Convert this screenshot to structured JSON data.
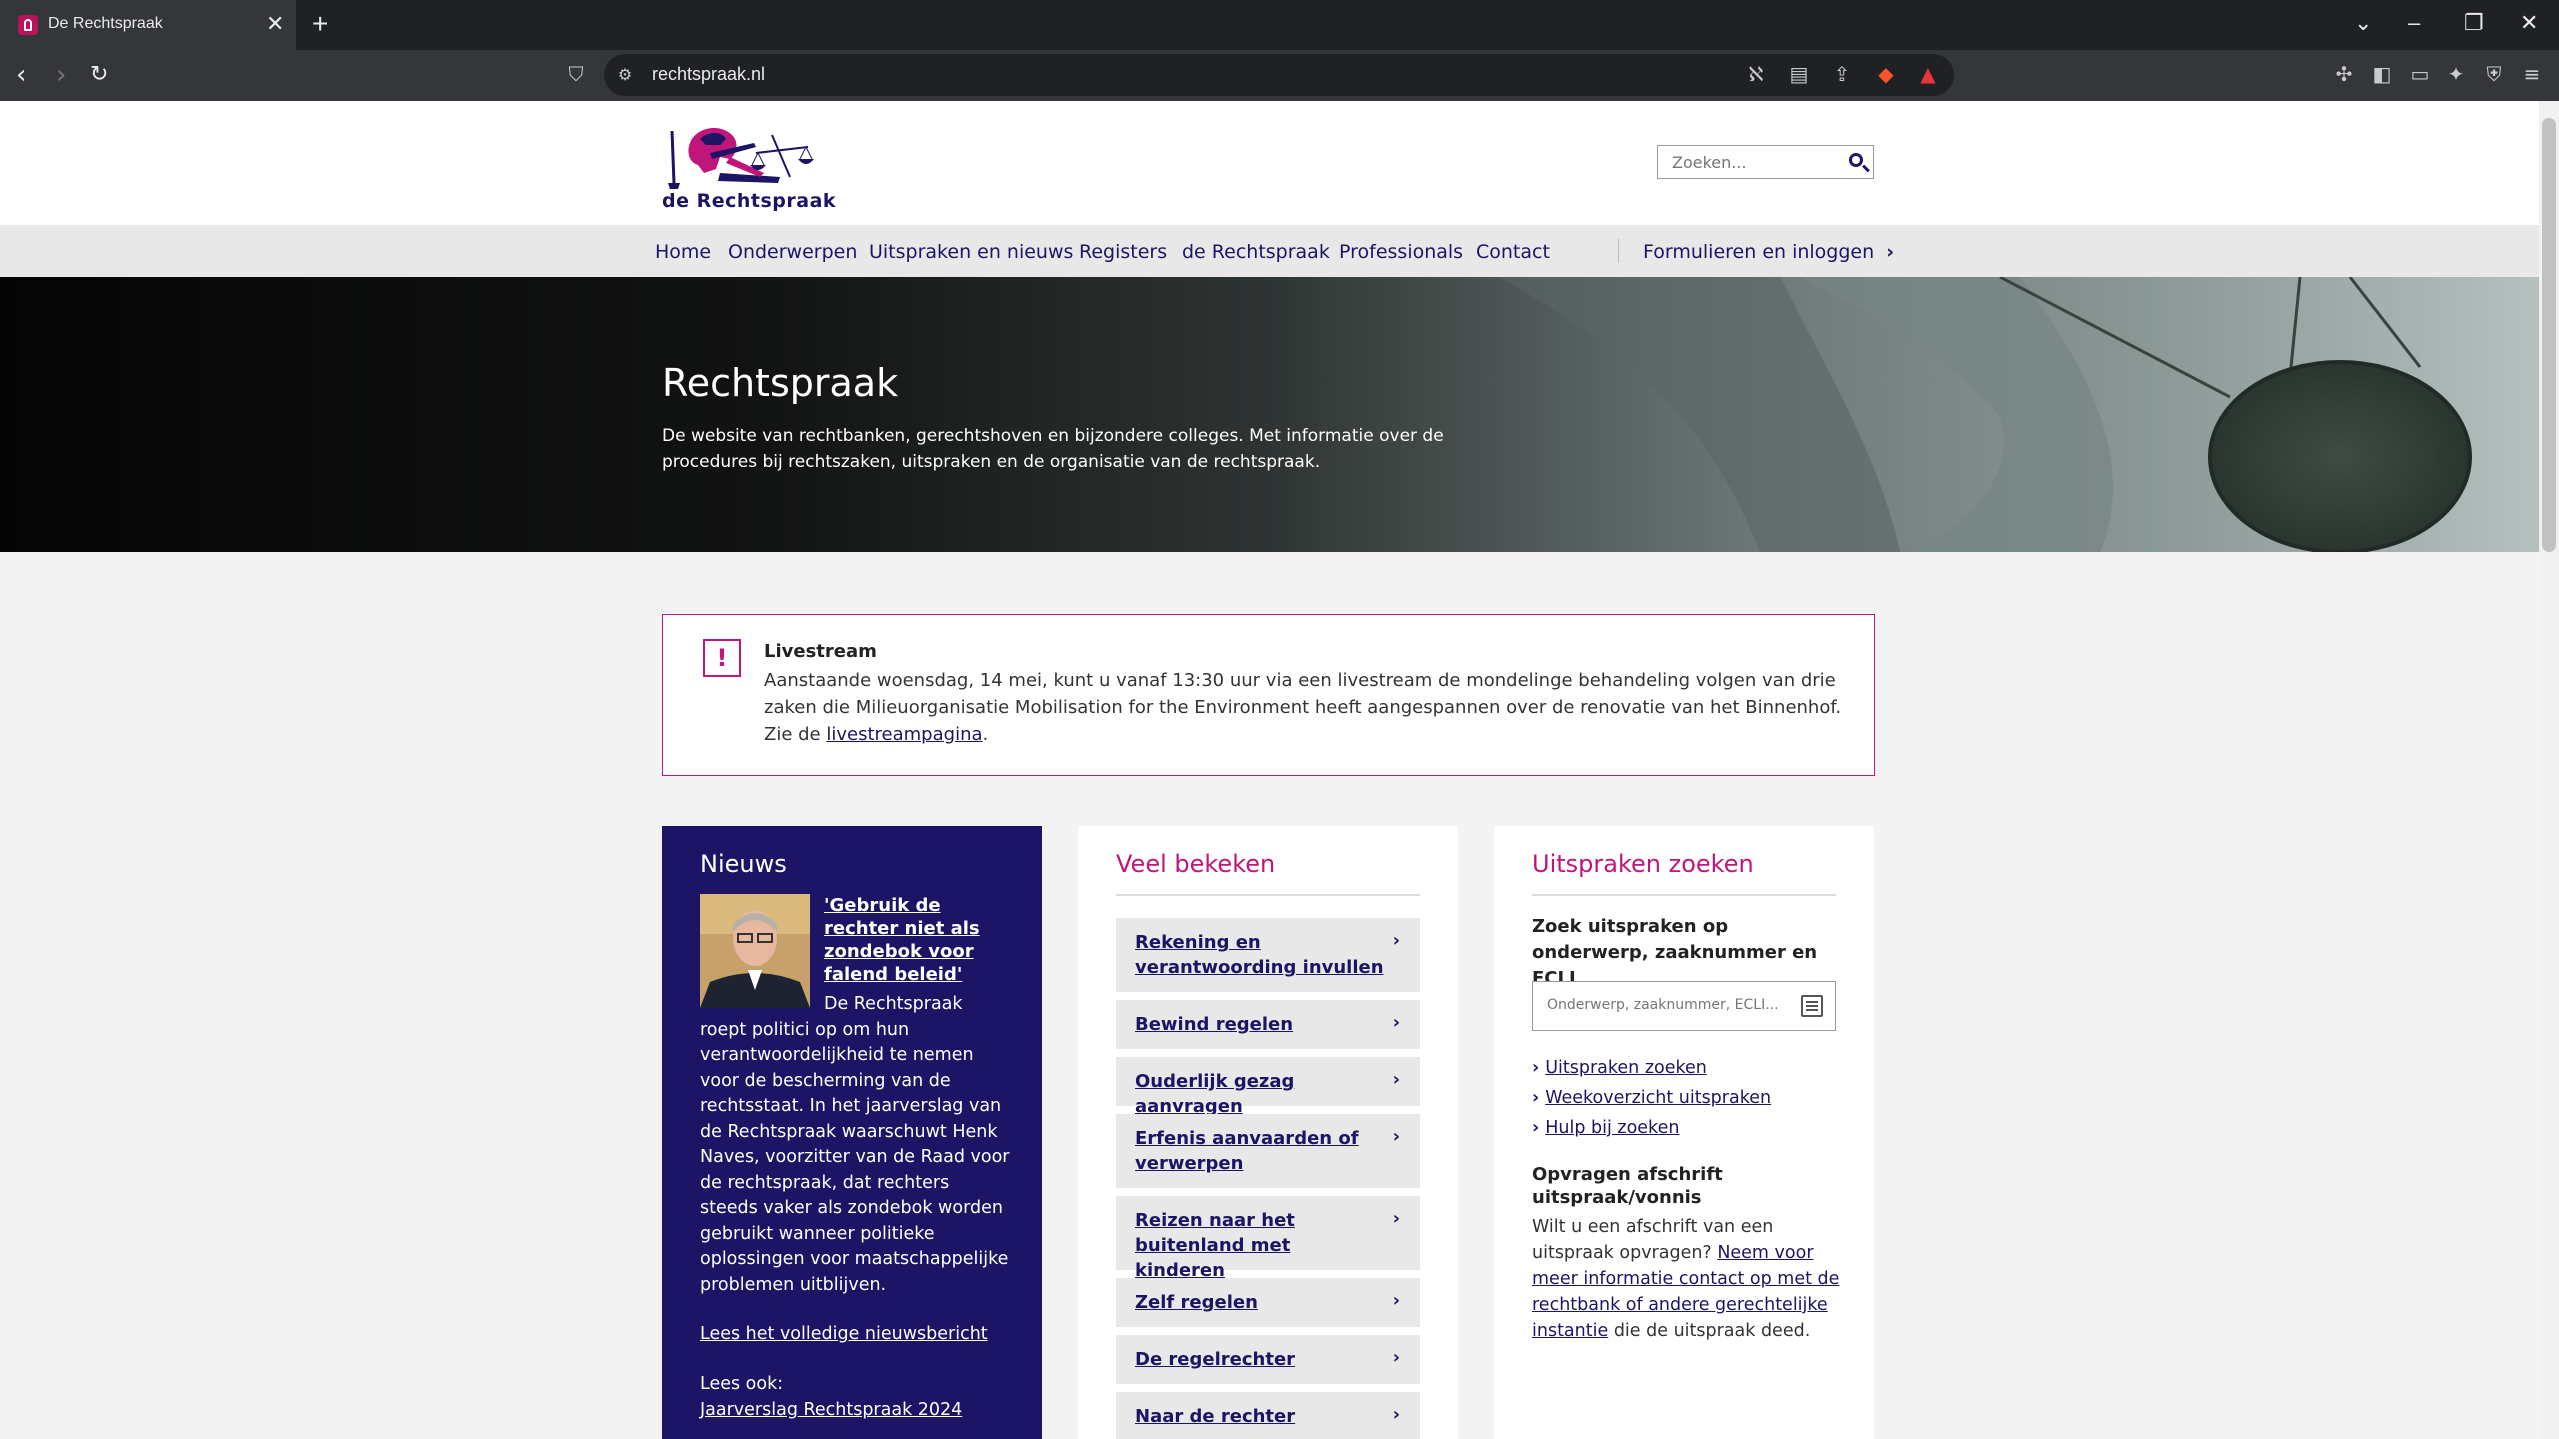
{
  "browser": {
    "tab_title": "De Rechtspraak",
    "tab_close": "✕",
    "new_tab": "+",
    "url": "rechtspraak.nl"
  },
  "site": {
    "logo_text": "de Rechtspraak",
    "search_placeholder": "Zoeken..."
  },
  "nav": {
    "items": [
      {
        "label": "Home"
      },
      {
        "label": "Onderwerpen"
      },
      {
        "label": "Uitspraken en nieuws"
      },
      {
        "label": "Registers"
      },
      {
        "label": "de Rechtspraak"
      },
      {
        "label": "Professionals"
      },
      {
        "label": "Contact"
      }
    ],
    "login": "Formulieren en inloggen",
    "login_chevron": "›"
  },
  "hero": {
    "title": "Rechtspraak",
    "text": "De website van rechtbanken, gerechtshoven en bijzondere colleges. Met informatie over de procedures bij rechtszaken, uitspraken en de organisatie van de rechtspraak."
  },
  "alert": {
    "icon": "!",
    "title": "Livestream",
    "body": "Aanstaande woensdag, 14 mei, kunt u vanaf 13:30 uur via een livestream de mondelinge behandeling volgen van drie zaken die Milieuorganisatie Mobilisation for the Environment heeft aangespannen over de renovatie van het Binnenhof. Zie de",
    "link": "livestreampagina",
    "end": "."
  },
  "news": {
    "title": "Nieuws",
    "headline": "'Gebruik de rechter niet als zondebok voor falend beleid'",
    "body": "De Rechtspraak roept politici op om hun verantwoordelijkheid te nemen voor de bescherming van de rechtsstaat. In het jaarverslag van de Rechtspraak waarschuwt Henk Naves, voorzitter van de Raad voor de rechtspraak, dat rechters steeds vaker als zondebok worden gebruikt wanneer politieke oplossingen voor maatschappelijke problemen uitblijven.",
    "read_more": "Lees het volledige nieuwsbericht",
    "also_label": "Lees ook:",
    "also_link": "Jaarverslag Rechtspraak 2024"
  },
  "veel": {
    "title": "Veel bekeken",
    "items": [
      {
        "label": "Rekening en verantwoording invullen"
      },
      {
        "label": "Bewind regelen"
      },
      {
        "label": "Ouderlijk gezag aanvragen"
      },
      {
        "label": "Erfenis aanvaarden of verwerpen"
      },
      {
        "label": "Reizen naar het buitenland met kinderen"
      },
      {
        "label": "Zelf regelen"
      },
      {
        "label": "De regelrechter"
      },
      {
        "label": "Naar de rechter"
      }
    ],
    "chevron": "›"
  },
  "uitspraken": {
    "title": "Uitspraken zoeken",
    "subtitle": "Zoek uitspraken op onderwerp, zaaknummer en ECLI",
    "input_placeholder": "Onderwerp, zaaknummer, ECLI...",
    "links": [
      {
        "label": "Uitspraken zoeken"
      },
      {
        "label": "Weekoverzicht uitspraken"
      },
      {
        "label": "Hulp bij zoeken"
      }
    ],
    "link_chevron": "›",
    "opv_title": "Opvragen afschrift uitspraak/vonnis",
    "opv_text": "Wilt u een afschrift van een uitspraak opvragen?",
    "opv_link": "Neem voor meer informatie contact op met de rechtbank of andere gerechtelijke instantie",
    "opv_end": "die de uitspraak deed."
  }
}
